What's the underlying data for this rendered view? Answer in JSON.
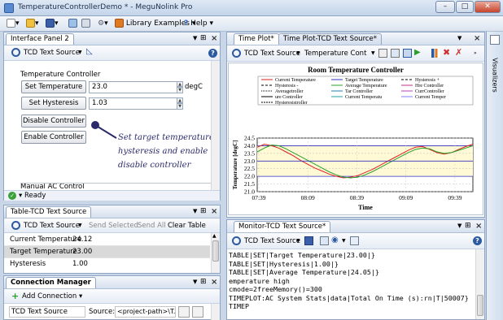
{
  "window": {
    "title": "TemperatureControllerDemo * - MeguNolink Pro",
    "minimize": "–",
    "maximize": "□",
    "close": "✕"
  },
  "toolbar": {
    "library_examples": "Library Examples",
    "help": "Help"
  },
  "interface_panel": {
    "tab": "Interface Panel 2",
    "source": "TCD Text Source",
    "group_title": "Temperature Controller",
    "set_temperature_label": "Set Temperature",
    "temperature_value": "23.0",
    "temperature_unit": "degC",
    "set_hysteresis_label": "Set Hysteresis",
    "hysteresis_value": "1.03",
    "disable_label": "Disable Controller",
    "enable_label": "Enable Controller",
    "note": [
      "Set target temperature,",
      "hysteresis and enable or",
      "disable controller"
    ],
    "manual_group": "Manual AC Control",
    "status": "Ready"
  },
  "table_panel": {
    "tab": "Table-TCD Text Source",
    "source": "TCD Text Source",
    "send_selected": "Send Selected",
    "send_all": "Send All",
    "clear_table": "Clear Table",
    "rows": [
      {
        "name": "Current Temperature",
        "value": "24.12"
      },
      {
        "name": "Target Temperature",
        "value": "23.00"
      },
      {
        "name": "Hysteresis",
        "value": "1.00"
      }
    ]
  },
  "connection_manager": {
    "tab": "Connection Manager",
    "add_connection": "Add Connection",
    "source_name": "TCD Text Source",
    "source_label": "Source:",
    "source_value": "<project-path>\\T..."
  },
  "plot_panel": {
    "tabs": [
      "Time Plot*",
      "Time Plot-TCD Text Source*"
    ],
    "source": "TCD Text Source",
    "series_select": "Temperature Cont",
    "side_tab": "Visualizers"
  },
  "chart_data": {
    "type": "line",
    "title": "Room Temperature Controller",
    "xlabel": "Time",
    "ylabel": "Temperature [degC]",
    "ylim": [
      21.0,
      24.5
    ],
    "y_ticks": [
      "24.5",
      "24.0",
      "23.5",
      "23.0",
      "22.5",
      "22.0",
      "21.5",
      "21.0"
    ],
    "x_ticks": [
      "07:39",
      "08:09",
      "08:39",
      "09:09",
      "09:39"
    ],
    "legend": [
      "Current Temperature",
      "Target Temperature",
      "Hysteresis +",
      "Hysteresis -",
      "Average Temperature",
      "Hre Controller",
      "Averagetroller",
      "Tar Controller",
      "CurrController",
      "ure Controller",
      "Current Temperatu",
      "Current Temper",
      "Hysteresistroller"
    ],
    "band": {
      "upper": 24.0,
      "lower": 22.0
    },
    "x": [
      0,
      5,
      10,
      15,
      20,
      25,
      30,
      35,
      40,
      45,
      50,
      55,
      60,
      65,
      70,
      75,
      80,
      85,
      90,
      95,
      100,
      105,
      110,
      115,
      120,
      125,
      130,
      135,
      140,
      145,
      150
    ],
    "series": [
      {
        "name": "Current Temperature",
        "color": "#e02020",
        "values": [
          23.9,
          24.1,
          24.0,
          23.85,
          23.6,
          23.35,
          23.05,
          22.8,
          22.55,
          22.35,
          22.15,
          22.0,
          21.9,
          21.95,
          22.05,
          22.25,
          22.45,
          22.7,
          22.95,
          23.2,
          23.45,
          23.7,
          23.9,
          23.95,
          23.75,
          23.55,
          23.45,
          23.55,
          23.75,
          23.95,
          24.1
        ]
      },
      {
        "name": "Average Temperature",
        "color": "#2aa02a",
        "values": [
          23.6,
          23.85,
          24.05,
          24.0,
          23.8,
          23.55,
          23.3,
          23.05,
          22.8,
          22.55,
          22.3,
          22.1,
          21.95,
          21.9,
          21.95,
          22.1,
          22.3,
          22.55,
          22.8,
          23.05,
          23.3,
          23.55,
          23.75,
          23.85,
          23.8,
          23.6,
          23.5,
          23.55,
          23.7,
          23.85,
          24.0
        ]
      },
      {
        "name": "Target Temperature",
        "color": "#3030c0",
        "values": [
          23.0,
          23.0,
          23.0,
          23.0,
          23.0,
          23.0,
          23.0,
          23.0,
          23.0,
          23.0,
          23.0,
          23.0,
          23.0,
          23.0,
          23.0,
          23.0,
          23.0,
          23.0,
          23.0,
          23.0,
          23.0,
          23.0,
          23.0,
          23.0,
          23.0,
          23.0,
          23.0,
          23.0,
          23.0,
          23.0,
          23.0
        ]
      }
    ]
  },
  "monitor_panel": {
    "tab": "Monitor-TCD Text Source*",
    "source": "TCD Text Source",
    "lines": [
      "TABLE|SET|Target Temperature|23.00|}",
      "TABLE|SET|Hysteresis|1.00|}",
      "TABLE|SET|Average Temperature|24.05|}",
      "emperature high",
      "cmode=2freeMemory()=300",
      "TIMEPLOT:AC System Stats|data|Total On Time (s):rn|T|50007}",
      "TIMEP"
    ]
  },
  "colors": {
    "accent": "#2c5aa0",
    "band": "#fff9d6",
    "plot_bg": "#ffffff"
  }
}
